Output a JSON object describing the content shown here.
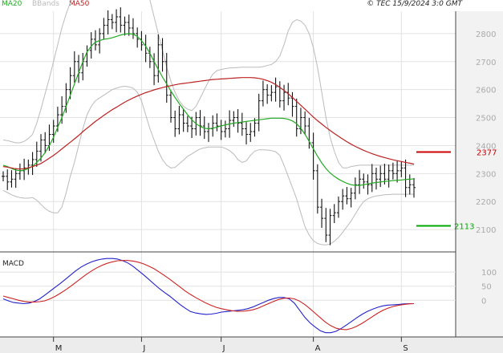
{
  "header": {
    "legend": [
      {
        "label": "MA20",
        "color": "#22aa22"
      },
      {
        "label": "BBands",
        "color": "#bbbbbb"
      },
      {
        "label": "MA50",
        "color": "#bb2222"
      }
    ],
    "copyright": "© TEC 15/9/2024 3:0 GMT"
  },
  "chart_data": [
    {
      "type": "line",
      "panel": "price",
      "ylim": [
        2020,
        2880
      ],
      "y_ticks": [
        {
          "label": "2800",
          "value": 2800
        },
        {
          "label": "2700",
          "value": 2700
        },
        {
          "label": "2600",
          "value": 2600
        },
        {
          "label": "2500",
          "value": 2500
        },
        {
          "label": "2400",
          "value": 2400
        },
        {
          "label": "2300",
          "value": 2300
        },
        {
          "label": "2200",
          "value": 2200
        },
        {
          "label": "2100",
          "value": 2100
        }
      ],
      "x_ticks": [
        {
          "label": "M",
          "index": 12
        },
        {
          "label": "J",
          "index": 33
        },
        {
          "label": "J",
          "index": 52
        },
        {
          "label": "A",
          "index": 74
        },
        {
          "label": "S",
          "index": 95
        }
      ],
      "series": [
        {
          "name": "MA20",
          "color": "#22aa22",
          "values": [
            2330,
            2325,
            2318,
            2312,
            2310,
            2312,
            2318,
            2326,
            2340,
            2355,
            2375,
            2400,
            2430,
            2465,
            2500,
            2540,
            2580,
            2620,
            2660,
            2700,
            2735,
            2755,
            2770,
            2775,
            2780,
            2782,
            2785,
            2790,
            2795,
            2798,
            2800,
            2798,
            2790,
            2775,
            2755,
            2730,
            2700,
            2672,
            2645,
            2620,
            2595,
            2572,
            2550,
            2530,
            2510,
            2492,
            2478,
            2468,
            2462,
            2460,
            2462,
            2466,
            2470,
            2474,
            2477,
            2480,
            2482,
            2484,
            2486,
            2488,
            2490,
            2492,
            2494,
            2496,
            2498,
            2498,
            2498,
            2497,
            2494,
            2488,
            2478,
            2462,
            2440,
            2415,
            2388,
            2362,
            2338,
            2318,
            2302,
            2290,
            2280,
            2272,
            2265,
            2260,
            2258,
            2258,
            2260,
            2263,
            2266,
            2268,
            2270,
            2272,
            2273,
            2275,
            2276,
            2277,
            2279,
            2280,
            2281
          ]
        },
        {
          "name": "MA50",
          "color": "#bb2222",
          "values": [
            2325,
            2323,
            2320,
            2317,
            2316,
            2317,
            2320,
            2325,
            2330,
            2336,
            2345,
            2355,
            2365,
            2376,
            2388,
            2400,
            2412,
            2424,
            2436,
            2450,
            2462,
            2474,
            2486,
            2497,
            2508,
            2518,
            2528,
            2537,
            2546,
            2555,
            2563,
            2570,
            2577,
            2583,
            2589,
            2594,
            2599,
            2603,
            2607,
            2611,
            2614,
            2617,
            2620,
            2622,
            2624,
            2626,
            2628,
            2630,
            2632,
            2634,
            2636,
            2637,
            2638,
            2639,
            2640,
            2641,
            2642,
            2643,
            2643,
            2643,
            2642,
            2640,
            2637,
            2632,
            2626,
            2618,
            2608,
            2597,
            2585,
            2572,
            2558,
            2544,
            2530,
            2516,
            2502,
            2489,
            2477,
            2465,
            2454,
            2443,
            2433,
            2423,
            2414,
            2405,
            2397,
            2390,
            2383,
            2377,
            2371,
            2366,
            2361,
            2357,
            2353,
            2349,
            2346,
            2343,
            2340,
            2337,
            2334
          ]
        },
        {
          "name": "Upper",
          "color": "#bbbbbb",
          "values": [
            2420,
            2418,
            2414,
            2410,
            2410,
            2415,
            2425,
            2440,
            2480,
            2530,
            2585,
            2640,
            2700,
            2760,
            2820,
            2870,
            2910,
            2940,
            2960,
            2975,
            2980,
            2982,
            2984,
            2985,
            2986,
            2987,
            2990,
            2992,
            2994,
            2995,
            2995,
            2993,
            2990,
            2980,
            2960,
            2920,
            2860,
            2800,
            2740,
            2680,
            2630,
            2590,
            2560,
            2540,
            2530,
            2525,
            2540,
            2570,
            2600,
            2630,
            2655,
            2668,
            2672,
            2675,
            2677,
            2678,
            2679,
            2680,
            2680,
            2680,
            2680,
            2680,
            2682,
            2686,
            2690,
            2700,
            2720,
            2760,
            2810,
            2840,
            2850,
            2845,
            2830,
            2800,
            2750,
            2680,
            2590,
            2500,
            2430,
            2380,
            2340,
            2320,
            2320,
            2325,
            2328,
            2330,
            2330,
            2330,
            2330,
            2330,
            2330,
            2330,
            2330,
            2330,
            2330,
            2330,
            2330,
            2330,
            2330
          ]
        },
        {
          "name": "Lower",
          "color": "#bbbbbb",
          "values": [
            2240,
            2232,
            2224,
            2218,
            2214,
            2212,
            2212,
            2214,
            2205,
            2190,
            2175,
            2165,
            2160,
            2160,
            2180,
            2230,
            2290,
            2340,
            2400,
            2460,
            2510,
            2540,
            2560,
            2570,
            2580,
            2590,
            2600,
            2605,
            2610,
            2612,
            2610,
            2605,
            2590,
            2560,
            2510,
            2460,
            2420,
            2380,
            2350,
            2330,
            2320,
            2322,
            2335,
            2348,
            2362,
            2370,
            2380,
            2388,
            2392,
            2395,
            2395,
            2395,
            2395,
            2390,
            2382,
            2370,
            2350,
            2340,
            2345,
            2365,
            2380,
            2385,
            2385,
            2384,
            2382,
            2378,
            2365,
            2330,
            2290,
            2250,
            2210,
            2160,
            2110,
            2080,
            2060,
            2050,
            2046,
            2045,
            2048,
            2058,
            2072,
            2090,
            2110,
            2130,
            2155,
            2180,
            2200,
            2210,
            2216,
            2220,
            2222,
            2224,
            2225,
            2226,
            2226,
            2226,
            2226,
            2226,
            2226
          ]
        }
      ],
      "bars_close": [
        2290,
        2270,
        2280,
        2300,
        2310,
        2320,
        2330,
        2350,
        2380,
        2420,
        2400,
        2440,
        2470,
        2510,
        2540,
        2600,
        2650,
        2700,
        2660,
        2700,
        2740,
        2780,
        2760,
        2800,
        2830,
        2850,
        2840,
        2860,
        2830,
        2840,
        2820,
        2800,
        2780,
        2760,
        2730,
        2700,
        2650,
        2760,
        2700,
        2580,
        2500,
        2460,
        2510,
        2480,
        2470,
        2460,
        2500,
        2470,
        2450,
        2460,
        2480,
        2470,
        2450,
        2460,
        2490,
        2500,
        2480,
        2460,
        2440,
        2450,
        2480,
        2560,
        2600,
        2580,
        2590,
        2610,
        2560,
        2590,
        2570,
        2540,
        2460,
        2500,
        2470,
        2410,
        2310,
        2180,
        2140,
        2080,
        2150,
        2160,
        2200,
        2220,
        2210,
        2230,
        2260,
        2280,
        2270,
        2260,
        2300,
        2280,
        2300,
        2280,
        2310,
        2300,
        2310,
        2320,
        2250,
        2260,
        2250
      ],
      "levels": [
        {
          "label": "2377",
          "value": 2377,
          "color": "#cc0000"
        },
        {
          "label": "2113",
          "value": 2113,
          "color": "#00aa00"
        }
      ]
    },
    {
      "type": "line",
      "panel": "macd",
      "title": "MACD",
      "ylim": [
        -130,
        160
      ],
      "y_ticks": [
        {
          "label": "100",
          "value": 100
        },
        {
          "label": "50",
          "value": 50
        },
        {
          "label": "0",
          "value": 0
        }
      ],
      "series": [
        {
          "name": "MACD",
          "color": "#2222cc",
          "values": [
            5,
            -2,
            -8,
            -10,
            -12,
            -10,
            -4,
            5,
            18,
            32,
            46,
            60,
            75,
            90,
            105,
            118,
            128,
            136,
            142,
            146,
            148,
            148,
            146,
            140,
            132,
            120,
            105,
            90,
            74,
            58,
            42,
            28,
            15,
            0,
            -15,
            -28,
            -40,
            -45,
            -48,
            -50,
            -49,
            -46,
            -42,
            -40,
            -38,
            -36,
            -34,
            -30,
            -24,
            -16,
            -8,
            0,
            6,
            10,
            10,
            5,
            -10,
            -35,
            -60,
            -80,
            -95,
            -108,
            -115,
            -115,
            -110,
            -100,
            -88,
            -75,
            -62,
            -50,
            -40,
            -32,
            -25,
            -20,
            -17,
            -16,
            -15,
            -13,
            -12,
            -12
          ]
        },
        {
          "name": "Signal",
          "color": "#cc2222",
          "values": [
            15,
            10,
            5,
            0,
            -4,
            -6,
            -6,
            -5,
            -2,
            5,
            14,
            25,
            37,
            50,
            64,
            78,
            92,
            104,
            115,
            124,
            131,
            136,
            140,
            141,
            141,
            139,
            135,
            129,
            121,
            112,
            100,
            88,
            75,
            61,
            47,
            33,
            21,
            10,
            0,
            -10,
            -18,
            -25,
            -30,
            -34,
            -37,
            -39,
            -39,
            -37,
            -34,
            -28,
            -20,
            -12,
            -4,
            3,
            7,
            8,
            5,
            -3,
            -15,
            -30,
            -46,
            -62,
            -78,
            -90,
            -99,
            -103,
            -104,
            -100,
            -92,
            -82,
            -70,
            -58,
            -46,
            -36,
            -28,
            -22,
            -18,
            -15,
            -13,
            -12
          ]
        }
      ]
    }
  ]
}
